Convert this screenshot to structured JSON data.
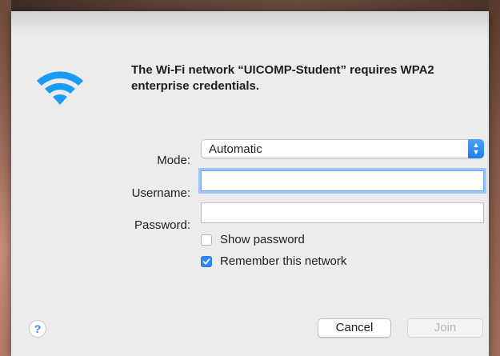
{
  "dialog": {
    "message": "The Wi-Fi network “UICOMP-Student” requires WPA2 enterprise credentials.",
    "icon": "wifi-icon",
    "accent_color": "#2f86f6",
    "wifi_color": "#1a9bf5"
  },
  "form": {
    "mode_label": "Mode:",
    "mode_value": "Automatic",
    "username_label": "Username:",
    "username_value": "",
    "password_label": "Password:",
    "password_value": "",
    "show_password_label": "Show password",
    "show_password_checked": false,
    "remember_label": "Remember this network",
    "remember_checked": true
  },
  "buttons": {
    "help_label": "?",
    "cancel_label": "Cancel",
    "join_label": "Join"
  }
}
